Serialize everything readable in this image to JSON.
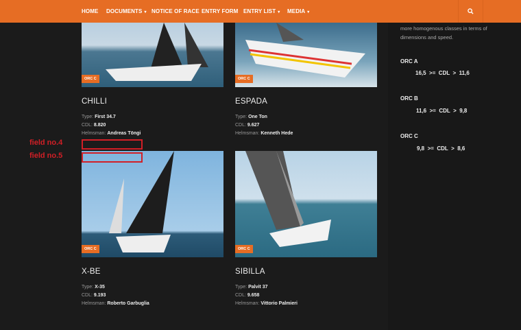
{
  "nav": {
    "items": [
      "HOME",
      "DOCUMENTS",
      "NOTICE OF RACE",
      "ENTRY FORM",
      "ENTRY LIST",
      "MEDIA"
    ],
    "caret": "▾",
    "search_icon": "search-icon"
  },
  "sidebar": {
    "intro": "more homogenous classes in terms of dimensions and speed.",
    "classes": [
      {
        "name": "ORC A",
        "rule": "16,5  >=  CDL  >  11,6"
      },
      {
        "name": "ORC B",
        "rule": "11,6  >=  CDL  >  9,8"
      },
      {
        "name": "ORC C",
        "rule": "9,8  >=  CDL  >  8,6"
      }
    ]
  },
  "labels": {
    "type": "Type:",
    "cdl": "CDL:",
    "helmsman": "Helmsman:"
  },
  "boats": [
    {
      "name": "CHILLI",
      "badge": "ORC C",
      "type": "First 34.7",
      "cdl": "8.820",
      "helmsman": "Andreas Töngi"
    },
    {
      "name": "ESPADA",
      "badge": "ORC C",
      "type": "One Ton",
      "cdl": "9.627",
      "helmsman": "Kenneth Hede"
    },
    {
      "name": "X-BE",
      "badge": "ORC C",
      "type": "X-35",
      "cdl": "9.193",
      "helmsman": "Roberto Garbuglia"
    },
    {
      "name": "SIBILLA",
      "badge": "ORC C",
      "type": "Palvit 37",
      "cdl": "9.658",
      "helmsman": "Vittorio Palmieri"
    }
  ],
  "annotations": [
    "field no.4",
    "field no.5"
  ],
  "colors": {
    "accent": "#e66d24",
    "annotation": "#d21f26"
  }
}
